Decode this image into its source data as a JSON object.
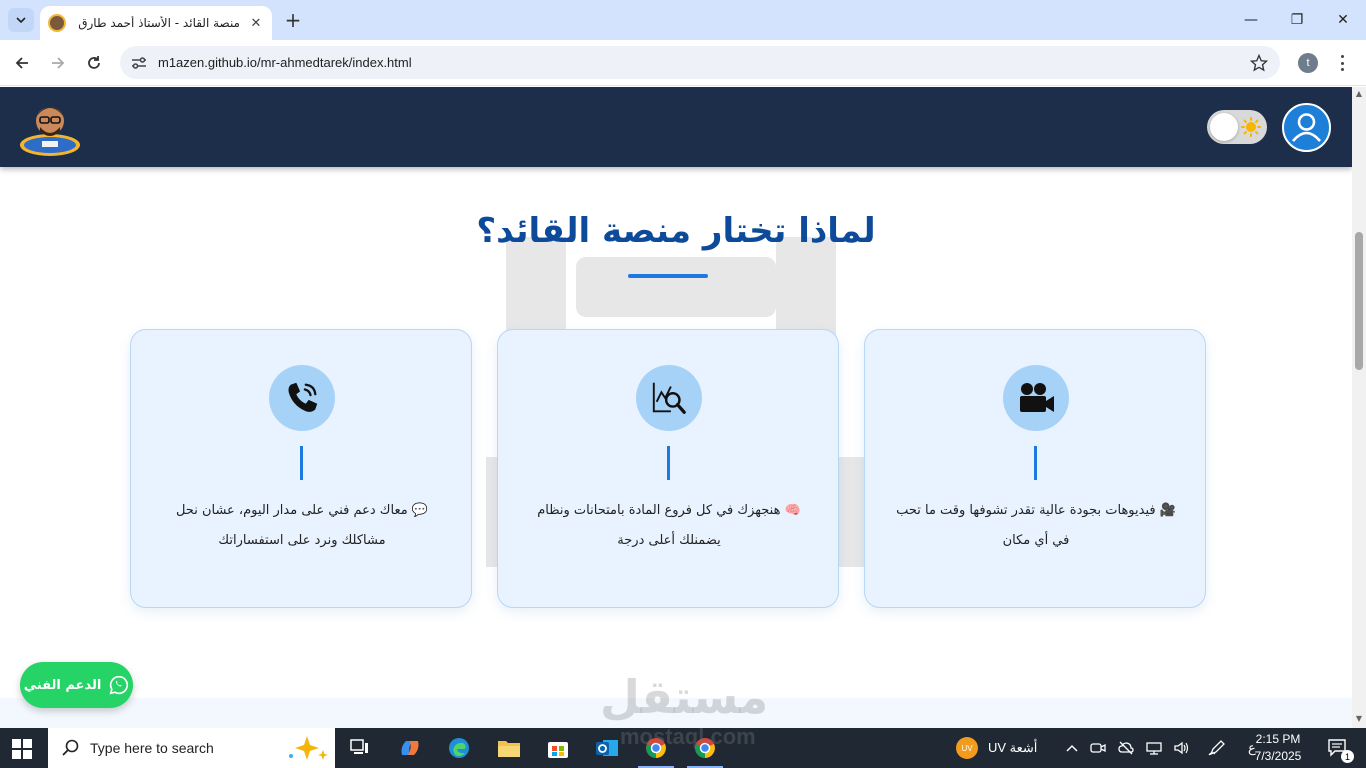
{
  "browser": {
    "tab_title": "منصة القائد - الأستاذ أحمد طارق",
    "tab_close": "✕",
    "new_tab": "+",
    "url": "m1azen.github.io/mr-ahmedtarek/index.html",
    "profile_initial": "t",
    "window_controls": {
      "minimize": "—",
      "maximize": "❐",
      "close": "✕"
    }
  },
  "site": {
    "section_title": "لماذا تختار منصة القائد؟",
    "cards": [
      {
        "icon": "phone-icon",
        "text": "💬 معاك دعم فني على مدار اليوم، عشان نحل مشاكلك ونرد على استفساراتك"
      },
      {
        "icon": "chart-search-icon",
        "text": "🧠 هنجهزك في كل فروع المادة بامتحانات ونظام يضمنلك أعلى درجة"
      },
      {
        "icon": "video-camera-icon",
        "text": "🎥 فيديوهات بجودة عالية تقدر تشوفها وقت ما تحب في أي مكان"
      }
    ],
    "support_button": "الدعم الفني",
    "watermark": "مستقل",
    "watermark_sub": "mostaql.com"
  },
  "taskbar": {
    "search_placeholder": "Type here to search",
    "weather_badge": "UV",
    "weather_text": "أشعة UV",
    "language": "ع",
    "time": "2:15 PM",
    "date": "7/3/2025",
    "notification_count": "1"
  },
  "colors": {
    "header_bg": "#1c2e4a",
    "title": "#0d4a9a",
    "accent": "#1d78e0",
    "card_bg": "#e8f3ff",
    "whatsapp": "#25d366"
  }
}
